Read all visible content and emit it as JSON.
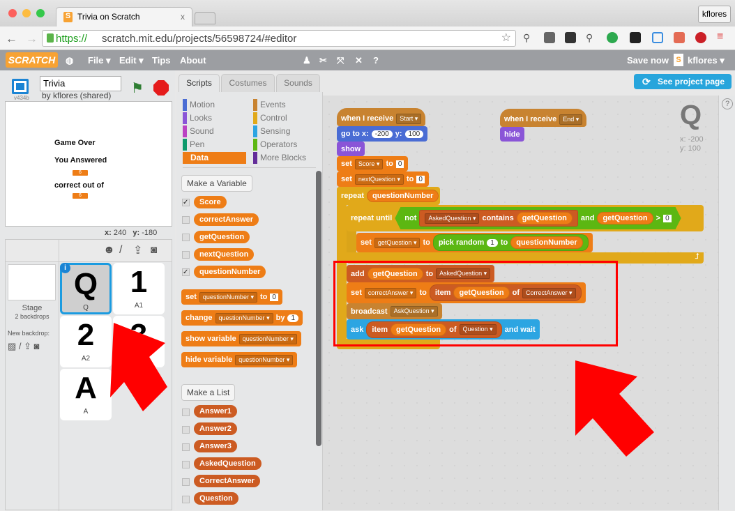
{
  "browser": {
    "tab_title": "Trivia on Scratch",
    "tab_close": "x",
    "favicon": "S",
    "user": "kflores",
    "url_scheme": "https://",
    "url_rest": "scratch.mit.edu/projects/56598724/#editor"
  },
  "menu": {
    "logo": "SCRATCH",
    "file": "File ▾",
    "edit": "Edit ▾",
    "tips": "Tips",
    "about": "About",
    "save": "Save now",
    "user": "kflores ▾",
    "icons": [
      "duplicate-icon",
      "cut-icon",
      "grow-icon",
      "shrink-icon",
      "help-icon"
    ]
  },
  "stage_panel": {
    "title": "Trivia",
    "byline": "by kflores (shared)",
    "version": "v434b",
    "stage_text": {
      "line1": "Game Over",
      "line2": "You Answered",
      "mon1": "6",
      "line3": "correct out of",
      "mon2": "6"
    },
    "coords": {
      "x_label": "x:",
      "x": "240",
      "y_label": "y:",
      "y": "-180"
    }
  },
  "sprites": {
    "stage_label": "Stage",
    "backdrops": "2 backdrops",
    "new_backdrop": "New backdrop:",
    "items": [
      {
        "glyph": "Q",
        "name": "Q"
      },
      {
        "glyph": "1",
        "name": "A1"
      },
      {
        "glyph": "2",
        "name": "A2"
      },
      {
        "glyph": "3",
        "name": ""
      },
      {
        "glyph": "A",
        "name": "A"
      }
    ]
  },
  "palette": {
    "tabs": [
      "Scripts",
      "Costumes",
      "Sounds"
    ],
    "categories": [
      {
        "label": "Motion",
        "color": "#4a6cd4"
      },
      {
        "label": "Events",
        "color": "#c88330"
      },
      {
        "label": "Looks",
        "color": "#8a55d7"
      },
      {
        "label": "Control",
        "color": "#e1a91a"
      },
      {
        "label": "Sound",
        "color": "#bb42c3"
      },
      {
        "label": "Sensing",
        "color": "#2ca5e2"
      },
      {
        "label": "Pen",
        "color": "#0e9a6c"
      },
      {
        "label": "Operators",
        "color": "#5cb712"
      },
      {
        "label": "Data",
        "color": "#ee7d16"
      },
      {
        "label": "More Blocks",
        "color": "#632d99"
      }
    ],
    "make_variable": "Make a Variable",
    "variables": [
      {
        "name": "Score",
        "checked": true
      },
      {
        "name": "correctAnswer",
        "checked": false
      },
      {
        "name": "getQuestion",
        "checked": false
      },
      {
        "name": "nextQuestion",
        "checked": false
      },
      {
        "name": "questionNumber",
        "checked": true
      }
    ],
    "blocks": {
      "set": "set",
      "to": "to",
      "var": "questionNumber",
      "zero": "0",
      "change": "change",
      "by": "by",
      "one": "1",
      "show_var": "show variable",
      "hide_var": "hide variable"
    },
    "make_list": "Make a List",
    "lists": [
      "Answer1",
      "Answer2",
      "Answer3",
      "AskedQuestion",
      "CorrectAnswer",
      "Question"
    ]
  },
  "header": {
    "see_project": "See project page"
  },
  "sprite_info": {
    "glyph": "Q",
    "x": "x: -200",
    "y": "y: 100"
  },
  "scripts": {
    "when_receive": "when I receive",
    "start": "Start",
    "end": "End",
    "goto": "go to x:",
    "gx": "-200",
    "y": "y:",
    "gy": "100",
    "show": "show",
    "hide": "hide",
    "set": "set",
    "to": "to",
    "score": "Score",
    "zero": "0",
    "nextq": "nextQuestion",
    "repeat": "repeat",
    "qnum": "questionNumber",
    "repeat_until": "repeat until",
    "not": "not",
    "asked": "AskedQuestion",
    "contains": "contains",
    "getq": "getQuestion",
    "and": "and",
    "gt": ">",
    "pick": "pick random",
    "one": "1",
    "add": "add",
    "correct": "correctAnswer",
    "item": "item",
    "of": "of",
    "CorrectAnswer": "CorrectAnswer",
    "broadcast": "broadcast",
    "askq": "AskQuestion",
    "ask": "ask",
    "question": "Question",
    "and_wait": "and wait"
  },
  "annotation_color": "#ff0000"
}
